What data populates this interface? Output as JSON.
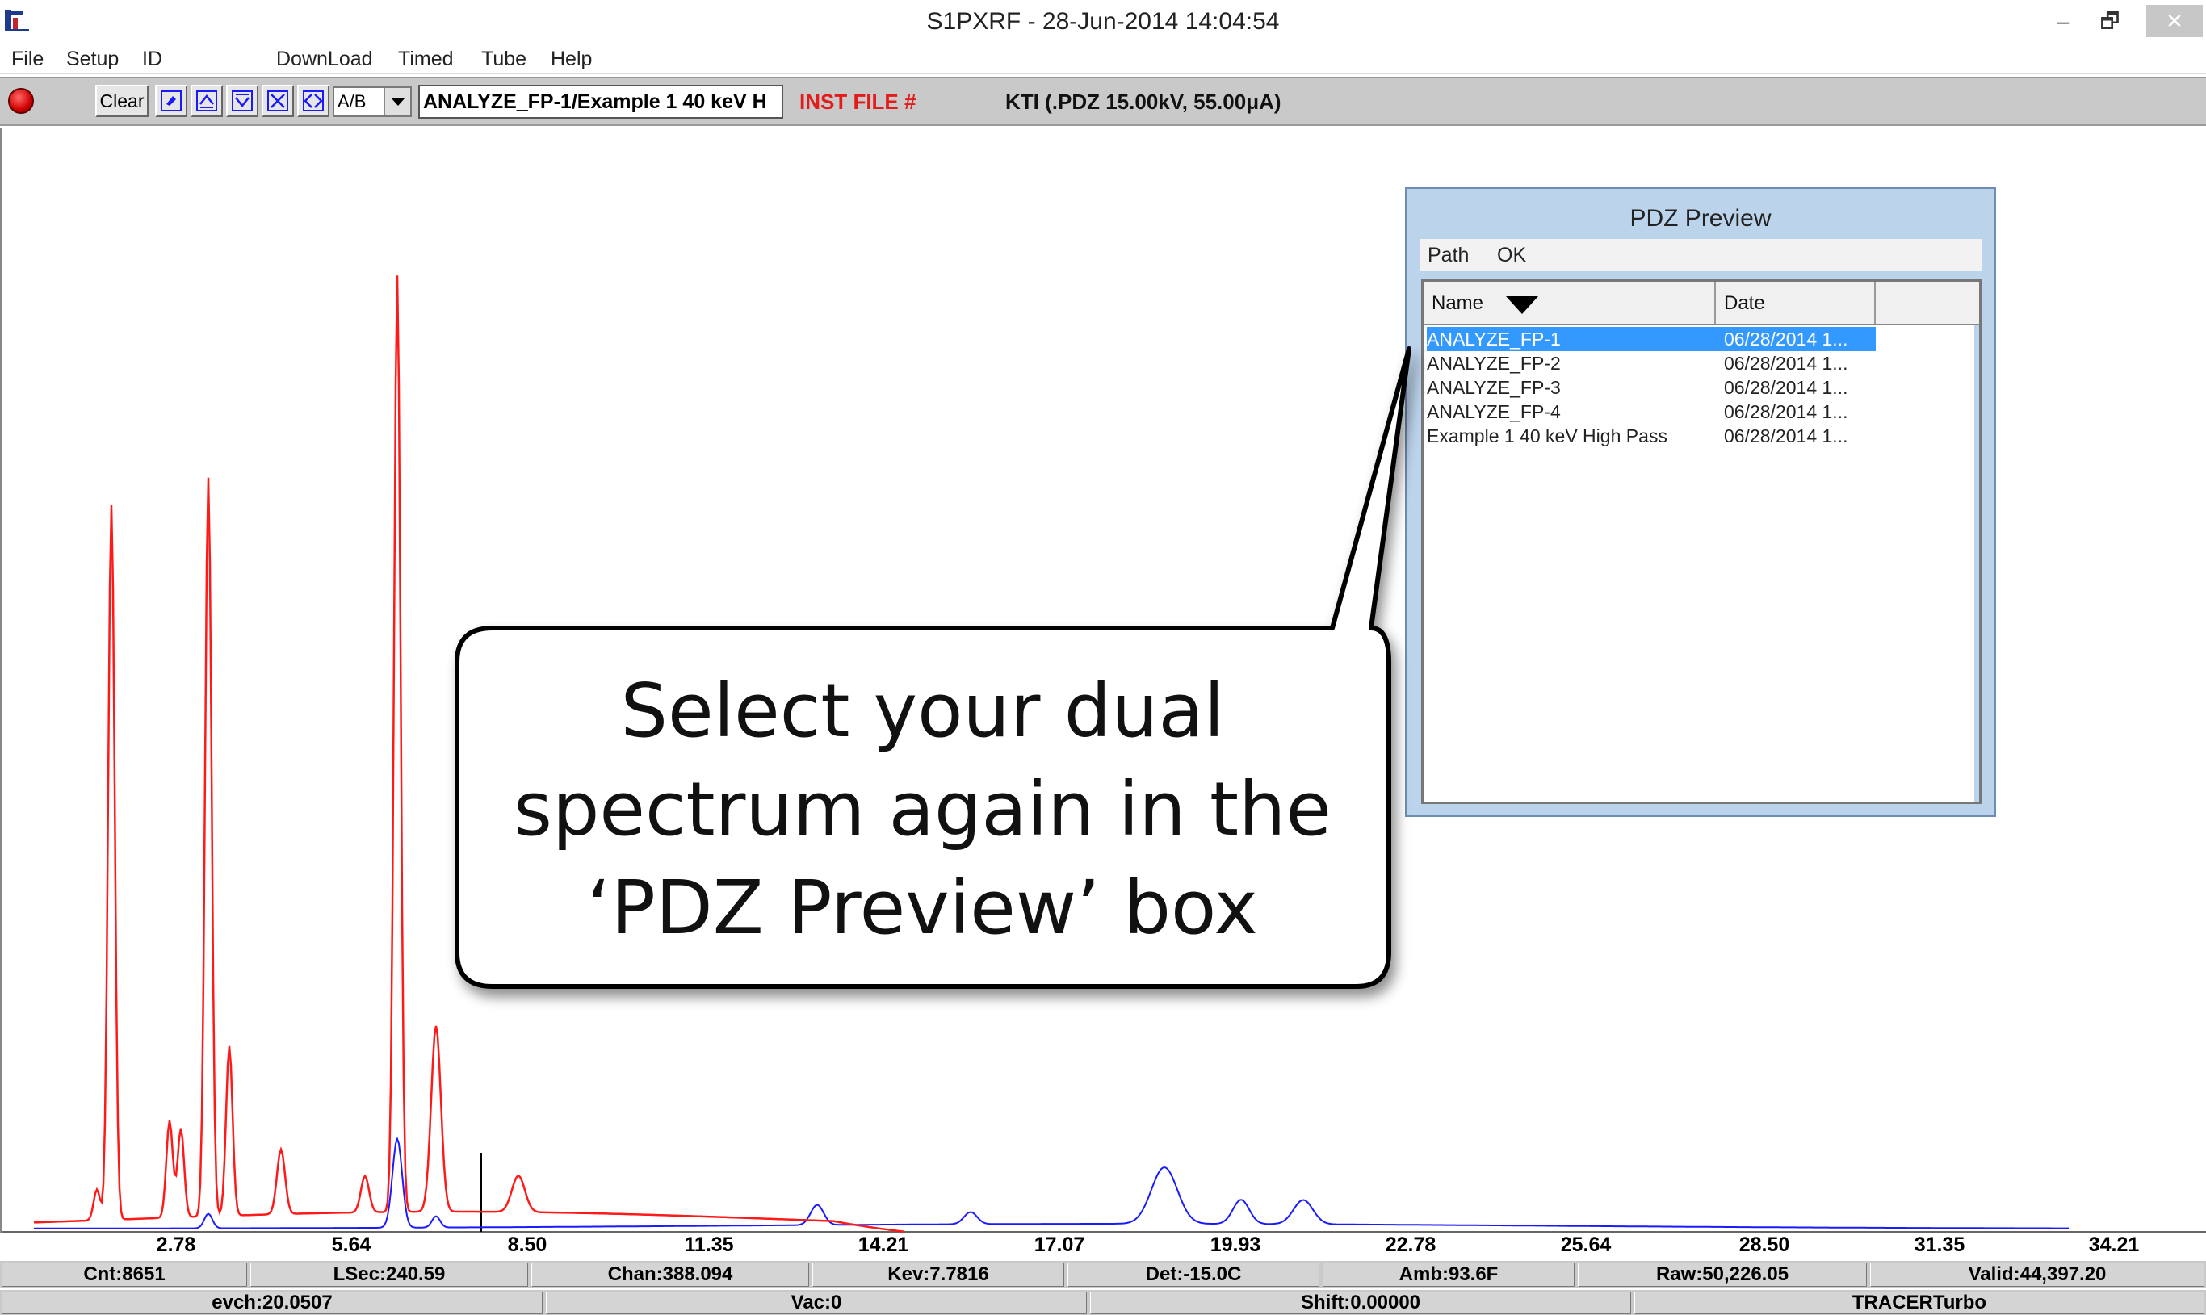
{
  "window": {
    "title": "S1PXRF - 28-Jun-2014 14:04:54",
    "minimize": "–",
    "restore": "🗗",
    "close": "✕"
  },
  "menu": [
    "File",
    "Setup",
    "ID",
    "DownLoad",
    "Timed",
    "Tube",
    "Help"
  ],
  "toolbar": {
    "clear_label": "Clear",
    "ab_value": "A/B",
    "file_value": "ANALYZE_FP-1/Example 1 40 keV H",
    "inst_file": "INST FILE #",
    "kti": "KTI  (.PDZ 15.00kV, 55.00μA)"
  },
  "colors": {
    "red_series": "#ff1a1a",
    "blue_series": "#1a1aff",
    "selection": "#3399ff",
    "inst_file": "#e21b1b"
  },
  "axis": {
    "ticks": [
      "2.78",
      "5.64",
      "8.50",
      "11.35",
      "14.21",
      "17.07",
      "19.93",
      "22.78",
      "25.64",
      "28.50",
      "31.35",
      "34.21"
    ]
  },
  "status": {
    "row1": [
      "Cnt:8651",
      "LSec:240.59",
      "Chan:388.094",
      "Kev:7.7816",
      "Det:-15.0C",
      "Amb:93.6F",
      "Raw:50,226.05",
      "Valid:44,397.20"
    ],
    "row2": [
      "evch:20.0507",
      "Vac:0",
      "Shift:0.00000",
      "TRACERTurbo"
    ]
  },
  "pdz_preview": {
    "title": "PDZ Preview",
    "menu": [
      "Path",
      "OK"
    ],
    "columns": [
      "Name",
      "Date"
    ],
    "rows": [
      {
        "name": "ANALYZE_FP-1",
        "date": "06/28/2014 1...",
        "selected": true
      },
      {
        "name": "ANALYZE_FP-2",
        "date": "06/28/2014 1...",
        "selected": false
      },
      {
        "name": "ANALYZE_FP-3",
        "date": "06/28/2014 1...",
        "selected": false
      },
      {
        "name": "ANALYZE_FP-4",
        "date": "06/28/2014 1...",
        "selected": false
      },
      {
        "name": "Example 1 40 keV High Pass",
        "date": "06/28/2014 1...",
        "selected": false
      }
    ]
  },
  "callout": {
    "line1": "Select your dual",
    "line2": "spectrum again in the",
    "line3": "‘PDZ Preview’ box"
  }
}
